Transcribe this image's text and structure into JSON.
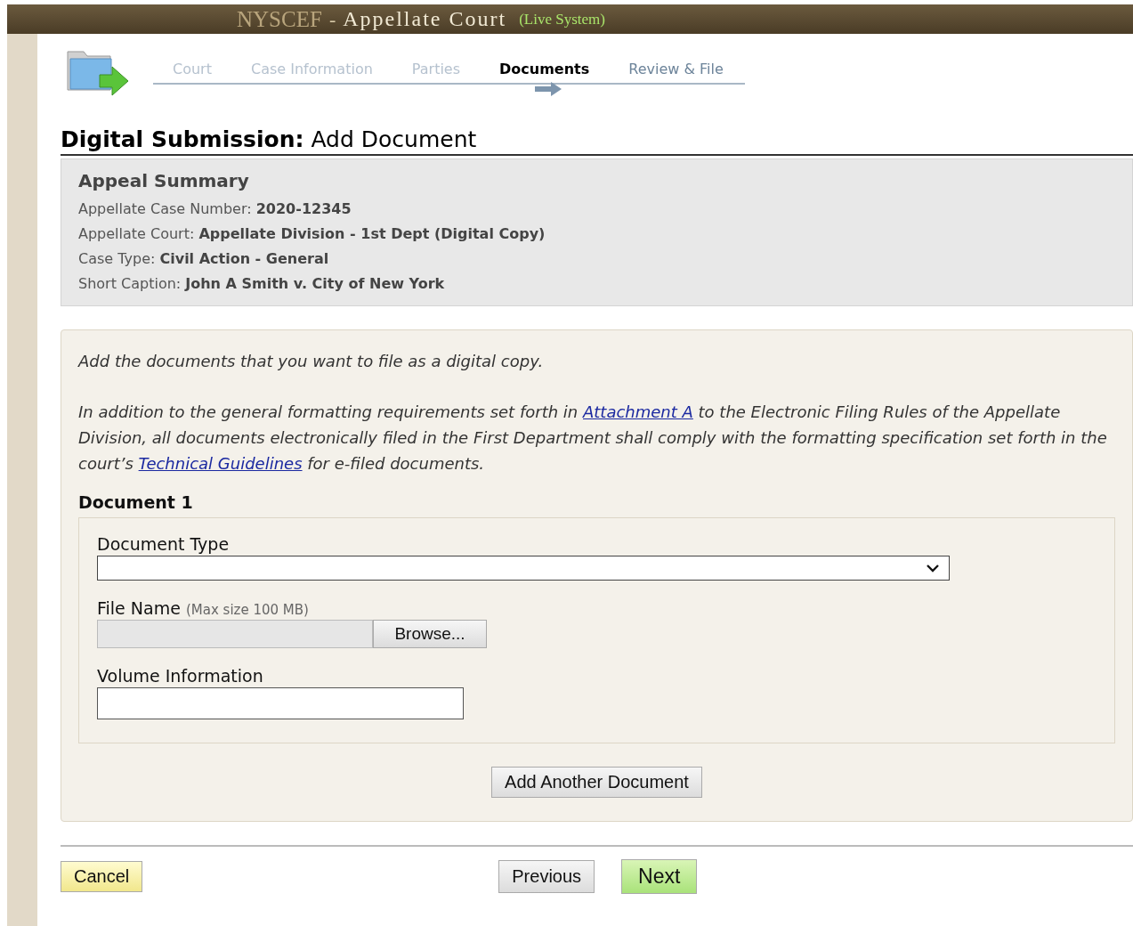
{
  "header": {
    "brand": "NYSCEF",
    "separator": "-",
    "title": "Appellate Court",
    "system": "(Live System)"
  },
  "steps": [
    {
      "label": "Court",
      "selected": false,
      "completed": true
    },
    {
      "label": "Case Information",
      "selected": false,
      "completed": true
    },
    {
      "label": "Parties",
      "selected": false,
      "completed": true
    },
    {
      "label": "Documents",
      "selected": true,
      "completed": false
    },
    {
      "label": "Review & File",
      "selected": false,
      "completed": false
    }
  ],
  "page_title": {
    "main": "Digital Submission:",
    "sub": "Add Document"
  },
  "summary": {
    "title": "Appeal Summary",
    "fields": [
      {
        "label": "Appellate Case Number:",
        "value": "2020-12345"
      },
      {
        "label": "Appellate Court:",
        "value": "Appellate Division - 1st Dept (Digital Copy)"
      },
      {
        "label": "Case Type:",
        "value": "Civil Action - General"
      },
      {
        "label": "Short Caption:",
        "value": "John A Smith v. City of New York"
      }
    ]
  },
  "instructions": {
    "intro": "Add the documents that you want to file as a digital copy.",
    "p_before": "In addition to the general formatting requirements set forth in",
    "link1": "Attachment A",
    "p_middle": "to the Electronic Filing Rules of the Appellate Division, all documents electronically filed in the First Department shall comply with the formatting specification set forth in the court’s",
    "link2": "Technical Guidelines",
    "p_after": "for e-filed documents."
  },
  "document": {
    "title": "Document 1",
    "type_label": "Document Type",
    "file_label": "File Name",
    "file_hint": "(Max size 100 MB)",
    "browse": "Browse...",
    "volume_label": "Volume Information"
  },
  "add_button": "Add Another Document",
  "buttons": {
    "cancel": "Cancel",
    "previous": "Previous",
    "next": "Next"
  }
}
